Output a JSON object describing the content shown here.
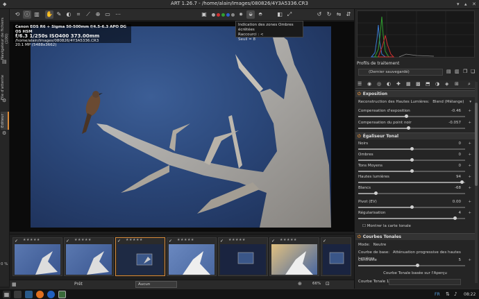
{
  "window": {
    "title": "ART 1.26.7 - /home/alain/Images/080826/4Y3A5336.CR3"
  },
  "left_tabs": {
    "browser": "Navigateur de fichiers (100)",
    "queue": "File d'attente",
    "editor": "Editeur"
  },
  "overlay": {
    "camera": "Canon EOS R6 + Sigma 50-500mm f/4.5-6.3 APO DG OS HSM",
    "exposure": "f/6.3  1/250s  ISO400  373.00mm",
    "path": "/home/alain/Images/080826/4Y3A5336.CR3",
    "size": "20.1 MP (5488x3662)"
  },
  "tooltip": {
    "line1": "Indication des zones Ombres écrêtées",
    "line2": "Raccourci : <",
    "line3": "Seuil = 8"
  },
  "filmstrip": {
    "stars": "★★★★★"
  },
  "bottombar": {
    "left_pct": "0 %",
    "status": "Prêt",
    "rank": "Aucun",
    "zoom": "66%"
  },
  "rightpanel": {
    "profile_title": "Profils de traitement",
    "profile_value": "(Dernier sauvegardé)",
    "exposure": {
      "title": "Exposition",
      "highlight_recon_label": "Reconstruction des Hautes Lumières:",
      "highlight_recon_value": "Blend (Mélange)",
      "comp_expo_label": "Compensation d'exposition",
      "comp_expo_value": "-0.46",
      "comp_expo_frac": 0.45,
      "black_label": "Compensation du point noir",
      "black_value": "-0.057",
      "black_frac": 0.47
    },
    "tone_eq": {
      "title": "Égaliseur Tonal",
      "rows": [
        {
          "label": "Noirs",
          "value": "0",
          "frac": 0.5
        },
        {
          "label": "Ombres",
          "value": "0",
          "frac": 0.5
        },
        {
          "label": "Tons Moyens",
          "value": "0",
          "frac": 0.5
        },
        {
          "label": "Hautes lumières",
          "value": "94",
          "frac": 0.97
        },
        {
          "label": "Blancs",
          "value": "-68",
          "frac": 0.16
        },
        {
          "label": "Pivot (EV)",
          "value": "0.00",
          "frac": 0.5
        },
        {
          "label": "Régularisation",
          "value": "4",
          "frac": 0.9
        }
      ],
      "show_map": "Montrer la carte tonale"
    },
    "curves": {
      "title": "Courbes Tonales",
      "mode_label": "Mode:",
      "mode_value": "Neutre",
      "base_label": "Courbe de base:",
      "base_value": "Atténuation progressive des hautes lumières",
      "contrast_label": "Contraste",
      "contrast_value": "5",
      "contrast_frac": 0.55,
      "curve_based": "Courbe Tonale basée sur l'Aperçu",
      "curve1_label": "Courbe Tonale 1:"
    }
  },
  "taskbar": {
    "lang": "FR",
    "time": "08:22"
  }
}
